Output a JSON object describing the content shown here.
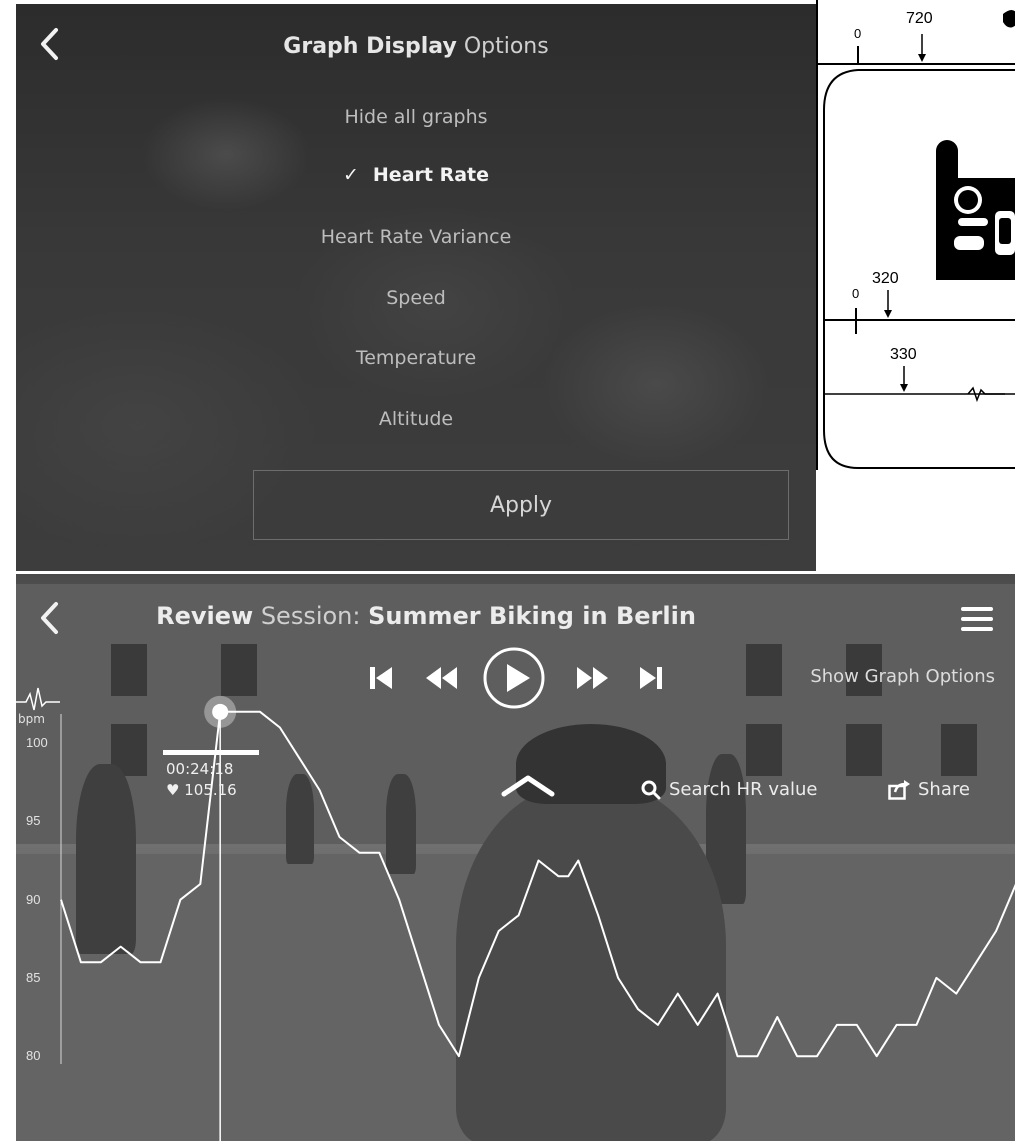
{
  "options_panel": {
    "title_bold": "Graph Display",
    "title_light": "Options",
    "back_icon": "chevron-left-icon",
    "items": [
      {
        "label": "Hide all graphs",
        "selected": false
      },
      {
        "label": "Heart Rate",
        "selected": true
      },
      {
        "label": "Heart Rate Variance",
        "selected": false
      },
      {
        "label": "Speed",
        "selected": false
      },
      {
        "label": "Temperature",
        "selected": false
      },
      {
        "label": "Altitude",
        "selected": false
      }
    ],
    "check_glyph": "✓",
    "apply_label": "Apply"
  },
  "figure_refs": {
    "r720": "720",
    "r720_zero": "0",
    "r320": "320",
    "r320_zero": "0",
    "r330": "330"
  },
  "review_panel": {
    "title_bold_1": "Review",
    "title_light": "Session:",
    "title_bold_2": "Summer Biking in Berlin",
    "show_graph_options": "Show Graph Options",
    "bpm_label": "bpm",
    "time_readout": "00:24:18",
    "hr_readout": "105.16",
    "search_label": "Search HR value",
    "share_label": "Share",
    "accent_color": "#ffffff"
  },
  "chart_data": {
    "type": "line",
    "ylabel": "bpm",
    "yticks": [
      "100",
      "95",
      "90",
      "85",
      "80"
    ],
    "ylim": [
      79.5,
      102.5
    ],
    "x": [
      0,
      1,
      2,
      3,
      4,
      5,
      6,
      7,
      8,
      9,
      10,
      11,
      12,
      13,
      14,
      15,
      16,
      17,
      18,
      19,
      20,
      21,
      22,
      23,
      24,
      25,
      25.5,
      26,
      27,
      28,
      29,
      30,
      31,
      32,
      33,
      34,
      35,
      36,
      37,
      38,
      39,
      40,
      41,
      42,
      43,
      44,
      45,
      46,
      47,
      48
    ],
    "values": [
      90,
      86,
      86,
      87,
      86,
      86,
      90,
      91,
      102,
      102,
      102,
      101,
      99,
      97,
      94,
      93,
      93,
      90,
      86,
      82,
      80,
      85,
      88,
      89,
      92.5,
      91.5,
      91.5,
      92.5,
      89,
      85,
      83,
      82,
      84,
      82,
      84,
      80,
      80,
      82.5,
      80,
      80,
      82,
      82,
      80,
      82,
      82,
      85,
      84,
      86,
      88,
      91
    ],
    "cursor_index": 8,
    "grid": false
  }
}
